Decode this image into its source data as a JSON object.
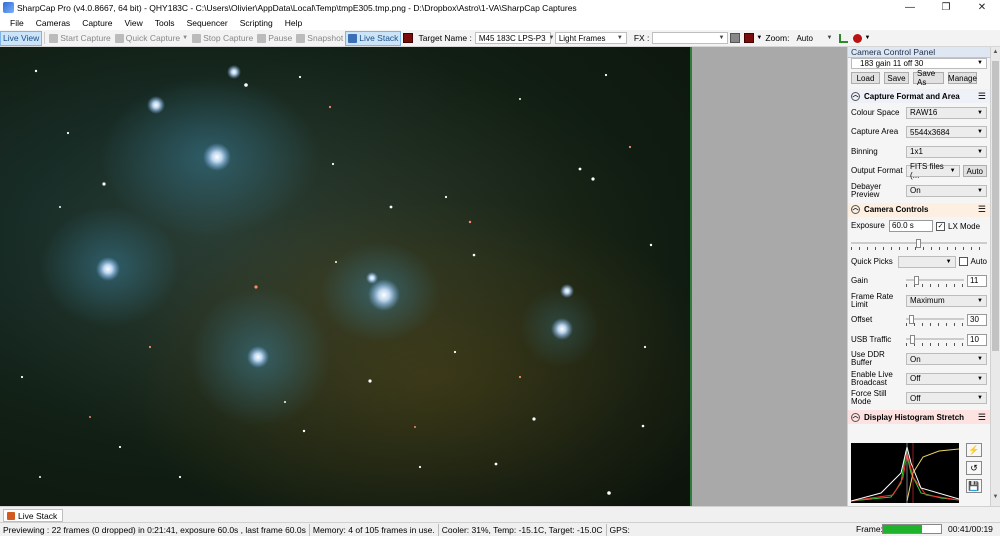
{
  "window": {
    "title": "SharpCap Pro (v4.0.8667, 64 bit) - QHY183C - C:\\Users\\Olivier\\AppData\\Local\\Temp\\tmpE305.tmp.png - D:\\Dropbox\\Astro\\1-VA\\SharpCap Captures",
    "minimize": "—",
    "maximize": "❐",
    "close": "✕"
  },
  "menu": [
    "File",
    "Cameras",
    "Capture",
    "View",
    "Tools",
    "Sequencer",
    "Scripting",
    "Help"
  ],
  "toolbar": {
    "live_view": "Live View",
    "start_capture": "Start Capture",
    "quick_capture": "Quick Capture",
    "stop_capture": "Stop Capture",
    "pause": "Pause",
    "snapshot": "Snapshot",
    "live_stack": "Live Stack",
    "target_name_label": "Target Name :",
    "target_name_value": "M45 183C LPS-P3",
    "frame_type": "Light Frames",
    "fx_label": "FX :",
    "fx_value": "",
    "zoom_label": "Zoom:",
    "zoom_value": "Auto"
  },
  "panel": {
    "title": "Camera Control Panel",
    "profile": "183 gain 11 off 30",
    "buttons": {
      "load": "Load",
      "save": "Save",
      "save_as": "Save As",
      "manage": "Manage"
    },
    "capture_format": {
      "header": "Capture Format and Area",
      "colour_space_label": "Colour Space",
      "colour_space": "RAW16",
      "capture_area_label": "Capture Area",
      "capture_area": "5544x3684",
      "binning_label": "Binning",
      "binning": "1x1",
      "output_format_label": "Output Format",
      "output_format": "FITS files (...",
      "auto_label": "Auto",
      "debayer_label": "Debayer Preview",
      "debayer": "On"
    },
    "camera_controls": {
      "header": "Camera Controls",
      "exposure_label": "Exposure",
      "exposure": "60.0 s",
      "lx_mode_label": "LX Mode",
      "lx_mode_checked": true,
      "quick_picks_label": "Quick Picks",
      "quick_picks": "",
      "quick_picks_auto": "Auto",
      "gain_label": "Gain",
      "gain": "11",
      "gain_fraction": 0.18,
      "frame_rate_label": "Frame Rate Limit",
      "frame_rate": "Maximum",
      "offset_label": "Offset",
      "offset": "30",
      "offset_fraction": 0.08,
      "usb_label": "USB Traffic",
      "usb": "10",
      "usb_fraction": 0.1,
      "ddr_label": "Use DDR Buffer",
      "ddr": "On",
      "live_broadcast_label": "Enable Live Broadcast",
      "live_broadcast": "Off",
      "force_still_label": "Force Still Mode",
      "force_still": "Off"
    },
    "histogram": {
      "header": "Display Histogram Stretch"
    }
  },
  "bottom_tab": "Live Stack",
  "status": {
    "preview": "Previewing : 22 frames (0 dropped) in 0:21:41, exposure 60.0s , last frame 60.0s",
    "memory": "Memory: 4 of 105 frames in use.",
    "cooler": "Cooler: 31%, Temp: -15.1C, Target: -15.0C",
    "gps": "GPS:",
    "frame_label": "Frame:",
    "frame_progress": 0.68,
    "frame_time": "00:41/00:19"
  },
  "colors": {
    "accent": "#3b6fb6",
    "histogram_header": "#fde2e2",
    "camera_header": "#fdf0e2",
    "format_header": "#eef1f7",
    "progress": "#1fb32c"
  }
}
